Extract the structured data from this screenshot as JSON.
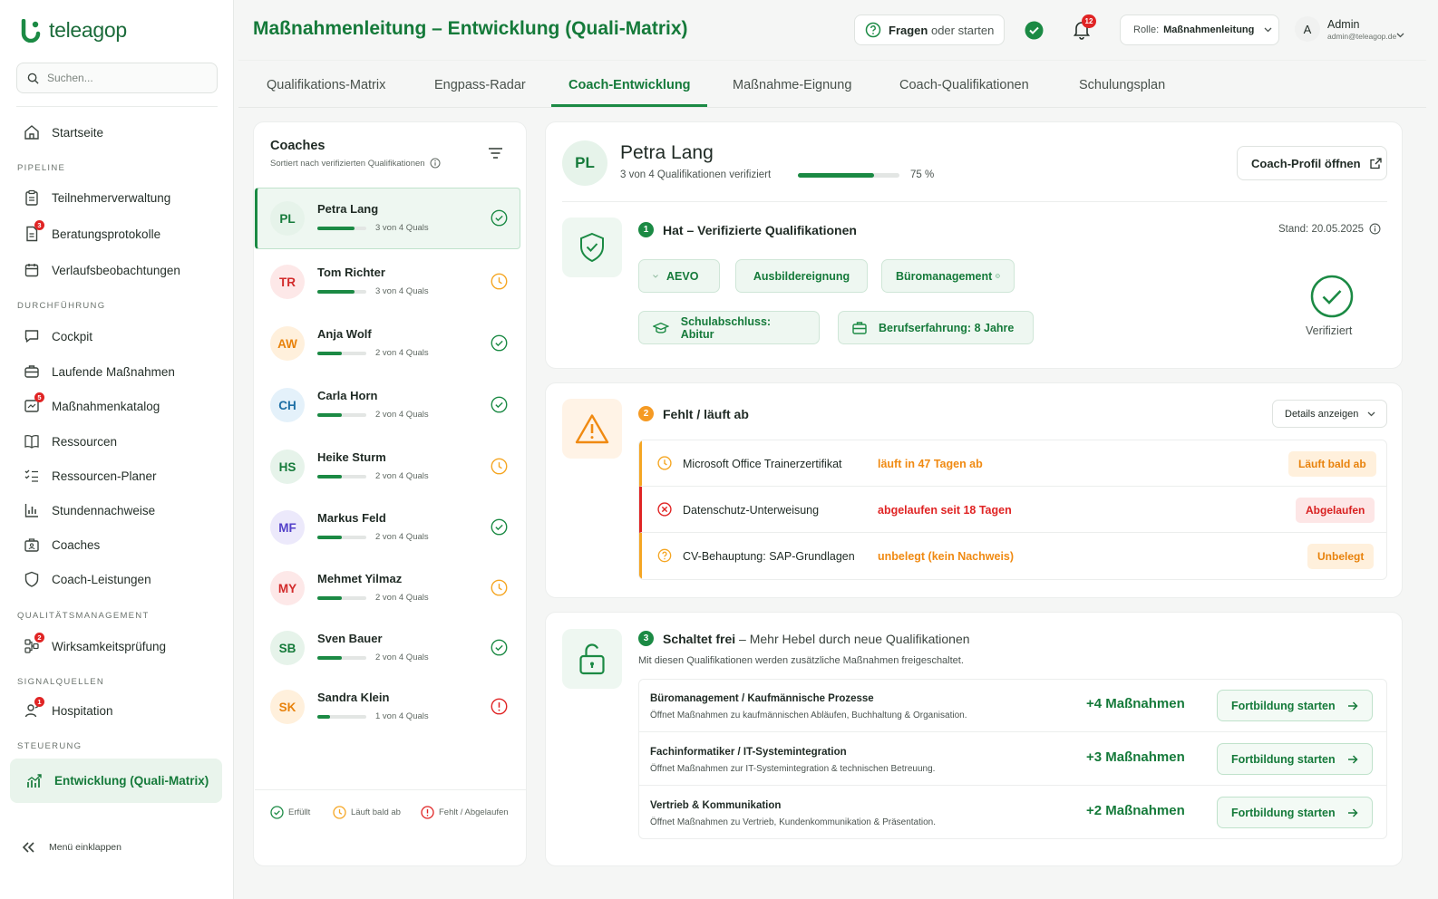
{
  "app": {
    "name": "teleagop",
    "page_title": "Maßnahmenleitung – Entwicklung (Quali-Matrix)"
  },
  "colors": {
    "brand": "#1b8a44",
    "warning": "#f5a623",
    "danger": "#e02424",
    "tile_green": "#eef7f1",
    "tile_orange": "#fff3e6"
  },
  "search": {
    "placeholder": "Suchen..."
  },
  "sidebar": {
    "top": [
      {
        "label": "Startseite",
        "icon": "home-icon"
      }
    ],
    "sections": [
      {
        "title": "PIPELINE",
        "items": [
          {
            "label": "Teilnehmerverwaltung",
            "icon": "clipboard-icon"
          },
          {
            "label": "Beratungsprotokolle",
            "icon": "document-icon",
            "badge": "3"
          },
          {
            "label": "Verlaufsbeobachtungen",
            "icon": "calendar-icon"
          }
        ]
      },
      {
        "title": "DURCHFÜHRUNG",
        "items": [
          {
            "label": "Cockpit",
            "icon": "chat-icon"
          },
          {
            "label": "Laufende Maßnahmen",
            "icon": "briefcase-icon"
          },
          {
            "label": "Maßnahmenkatalog",
            "icon": "catalog-icon",
            "badge": "5"
          },
          {
            "label": "Ressourcen",
            "icon": "book-icon"
          },
          {
            "label": "Ressourcen-Planer",
            "icon": "checklist-icon"
          },
          {
            "label": "Stundennachweise",
            "icon": "bar-chart-icon"
          },
          {
            "label": "Coaches",
            "icon": "coaches-icon"
          },
          {
            "label": "Coach-Leistungen",
            "icon": "shield-icon"
          }
        ]
      },
      {
        "title": "QUALITÄTSMANAGEMENT",
        "items": [
          {
            "label": "Wirksamkeitsprüfung",
            "icon": "flow-icon",
            "badge": "2"
          }
        ]
      },
      {
        "title": "SIGNALQUELLEN",
        "items": [
          {
            "label": "Hospitation",
            "icon": "user-icon",
            "badge": "1"
          }
        ]
      },
      {
        "title": "STEUERUNG",
        "items": [
          {
            "label": "Entwicklung (Quali-Matrix)",
            "icon": "trend-icon",
            "active": true
          }
        ]
      }
    ],
    "collapse_label": "Menü einklappen"
  },
  "header": {
    "ask_bold": "Fragen",
    "ask_rest": "oder starten",
    "notifications": "12",
    "role_label": "Rolle:",
    "role_value": "Maßnahmenleitung",
    "user_initial": "A",
    "user_name": "Admin",
    "user_email": "admin@teleagop.de"
  },
  "tabs": [
    {
      "label": "Qualifikations-Matrix"
    },
    {
      "label": "Engpass-Radar"
    },
    {
      "label": "Coach-Entwicklung",
      "active": true
    },
    {
      "label": "Maßnahme-Eignung"
    },
    {
      "label": "Coach-Qualifikationen"
    },
    {
      "label": "Schulungsplan"
    }
  ],
  "coaches": {
    "title": "Coaches",
    "subtitle": "Sortiert nach verifizierten Qualifikationen",
    "list": [
      {
        "initials": "PL",
        "name": "Petra Lang",
        "quals": "3 von 4 Quals",
        "progress": 0.75,
        "status": "ok",
        "selected": true
      },
      {
        "initials": "TR",
        "name": "Tom Richter",
        "quals": "3 von 4 Quals",
        "progress": 0.75,
        "status": "warn"
      },
      {
        "initials": "AW",
        "name": "Anja Wolf",
        "quals": "2 von 4 Quals",
        "progress": 0.5,
        "status": "ok"
      },
      {
        "initials": "CH",
        "name": "Carla Horn",
        "quals": "2 von 4 Quals",
        "progress": 0.5,
        "status": "ok"
      },
      {
        "initials": "HS",
        "name": "Heike Sturm",
        "quals": "2 von 4 Quals",
        "progress": 0.5,
        "status": "warn"
      },
      {
        "initials": "MF",
        "name": "Markus Feld",
        "quals": "2 von 4 Quals",
        "progress": 0.5,
        "status": "ok"
      },
      {
        "initials": "MY",
        "name": "Mehmet Yilmaz",
        "quals": "2 von 4 Quals",
        "progress": 0.5,
        "status": "warn"
      },
      {
        "initials": "SB",
        "name": "Sven Bauer",
        "quals": "2 von 4 Quals",
        "progress": 0.5,
        "status": "ok"
      },
      {
        "initials": "SK",
        "name": "Sandra Klein",
        "quals": "1 von 4 Quals",
        "progress": 0.25,
        "status": "error"
      }
    ],
    "legend": {
      "ok": "Erfüllt",
      "warn": "Läuft bald ab",
      "error": "Fehlt / Abgelaufen"
    }
  },
  "profile": {
    "initials": "PL",
    "name": "Petra Lang",
    "verified_text": "3 von 4 Qualifikationen verifiziert",
    "progress": 0.75,
    "percent_label": "75 %",
    "open_button": "Coach-Profil öffnen"
  },
  "verified_section": {
    "number": "1",
    "title": "Hat – Verifizierte Qualifikationen",
    "stand": "Stand: 20.05.2025",
    "chips": [
      "AEVO",
      "Ausbildereignung",
      "Büromanagement"
    ],
    "chips2": [
      {
        "label": "Schulabschluss: Abitur",
        "icon": "graduation-cap-icon"
      },
      {
        "label": "Berufserfahrung: 8 Jahre",
        "icon": "briefcase-icon"
      }
    ],
    "status_label": "Verifiziert"
  },
  "missing_section": {
    "number": "2",
    "title": "Fehlt / läuft ab",
    "details_button": "Details anzeigen",
    "rows": [
      {
        "title": "Microsoft Office Trainerzertifikat",
        "status": "läuft in 47 Tagen ab",
        "pill": "Läuft bald ab",
        "type": "warn"
      },
      {
        "title": "Datenschutz-Unterweisung",
        "status": "abgelaufen seit 18 Tagen",
        "pill": "Abgelaufen",
        "type": "error"
      },
      {
        "title": "CV-Behauptung: SAP-Grundlagen",
        "status": "unbelegt (kein Nachweis)",
        "pill": "Unbelegt",
        "type": "unbelegt"
      }
    ]
  },
  "unlock_section": {
    "number": "3",
    "title_bold": "Schaltet frei",
    "title_rest": "– Mehr Hebel durch neue Qualifikationen",
    "subtitle": "Mit diesen Qualifikationen werden zusätzliche Maßnahmen freigeschaltet.",
    "rows": [
      {
        "title": "Büromanagement / Kaufmännische Prozesse",
        "desc": "Öffnet Maßnahmen zu kaufmännischen Abläufen, Buchhaltung & Organisation.",
        "count": "+4 Maßnahmen",
        "button": "Fortbildung starten"
      },
      {
        "title": "Fachinformatiker / IT-Systemintegration",
        "desc": "Öffnet Maßnahmen zur IT-Systemintegration & technischen Betreuung.",
        "count": "+3 Maßnahmen",
        "button": "Fortbildung starten"
      },
      {
        "title": "Vertrieb & Kommunikation",
        "desc": "Öffnet Maßnahmen zu Vertrieb, Kundenkommunikation & Präsentation.",
        "count": "+2 Maßnahmen",
        "button": "Fortbildung starten"
      }
    ]
  }
}
